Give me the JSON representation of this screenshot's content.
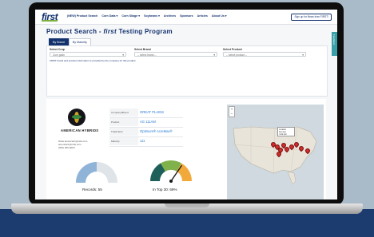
{
  "colors": {
    "brand_navy": "#13326e",
    "brand_green": "#7bb043",
    "accent_teal": "#3a9fa8",
    "link_blue": "#2a7bd4",
    "pin_red": "#d12b2b",
    "band_blue": "#1c3c70"
  },
  "nav": {
    "logo": "first",
    "links": [
      "(NEW) Product Search",
      "Corn Data ▾",
      "Corn Silage ▾",
      "Soybeans ▾",
      "Archives",
      "Sponsors",
      "Articles",
      "About Us ▾"
    ],
    "signup_button": "Sign up for News from FIRST!"
  },
  "page": {
    "title_prefix": "Product Search - ",
    "title_brand": "first",
    "title_suffix": " Testing Program",
    "side_tab": "Feedback"
  },
  "tabs": [
    {
      "label": "By Brand",
      "active": true
    },
    {
      "label": "By Maturity",
      "active": false
    }
  ],
  "filters": {
    "crop": {
      "label": "Select Crop",
      "value": "Corn grain"
    },
    "brand": {
      "label": "Select Brand",
      "value": "-- select brand --"
    },
    "product": {
      "label": "Select Product",
      "value": "-- select product --"
    },
    "note": "FIRST brand and product information is provided by the company for this product."
  },
  "company": {
    "name": "AMERICAN HYBRIDS",
    "address_lines": [
      "Www.americanhybrids.com",
      "americanhybrids.com",
      "(000) 000-0000"
    ]
  },
  "info": [
    {
      "key": "Company/Brand",
      "value": "GREAT PLAINS"
    },
    {
      "key": "Product",
      "value": "AG 111AM"
    },
    {
      "key": "Traits/Tech",
      "value": "Optimum® AcreMax®"
    },
    {
      "key": "Maturity",
      "value": "111"
    }
  ],
  "gauges": [
    {
      "label": "Records: 55",
      "level": 0.5,
      "kind": "half-fill"
    },
    {
      "label": "In Top 30: 69%",
      "level": 0.69,
      "kind": "colored"
    }
  ],
  "map": {
    "popup_title": "Location",
    "popup_lines": [
      "Test site",
      "Yield plot"
    ],
    "zoom_in": "+",
    "zoom_out": "−"
  }
}
